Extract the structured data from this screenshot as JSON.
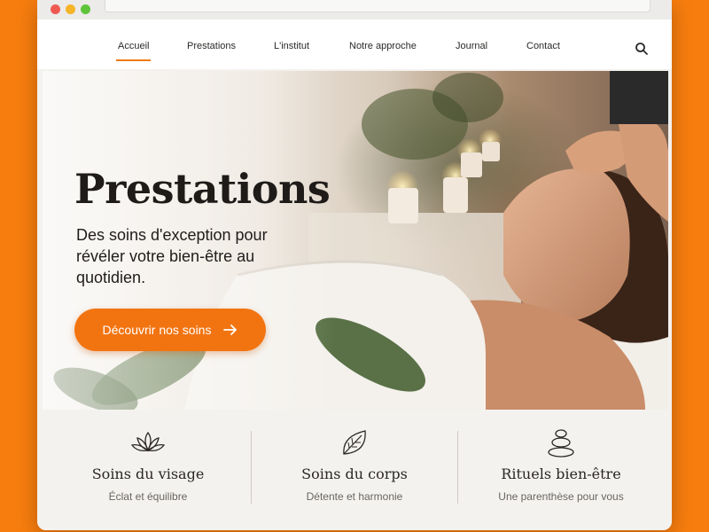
{
  "nav": {
    "items": [
      {
        "label": "Accueil",
        "active": true
      },
      {
        "label": "Prestations",
        "active": false
      },
      {
        "label": "L'institut",
        "active": false
      },
      {
        "label": "Notre approche",
        "active": false
      },
      {
        "label": "Journal",
        "active": false
      },
      {
        "label": "Contact",
        "active": false
      }
    ],
    "search_icon": "search-icon"
  },
  "hero": {
    "title": "Prestations",
    "subtitle": "Des soins d'exception pour révéler votre bien-être au quotidien.",
    "cta_label": "Découvrir nos soins",
    "cta_icon": "arrow-right-icon"
  },
  "features": [
    {
      "icon": "lotus-icon",
      "title": "Soins du visage",
      "subtitle": "Éclat et équilibre"
    },
    {
      "icon": "leaf-icon",
      "title": "Soins du corps",
      "subtitle": "Détente et harmonie"
    },
    {
      "icon": "stones-icon",
      "title": "Rituels bien-être",
      "subtitle": "Une parenthèse pour vous"
    }
  ],
  "colors": {
    "accent": "#f27411",
    "page_background": "#f77d0e",
    "text_dark": "#1e1b19",
    "text_muted": "#6a6560"
  }
}
